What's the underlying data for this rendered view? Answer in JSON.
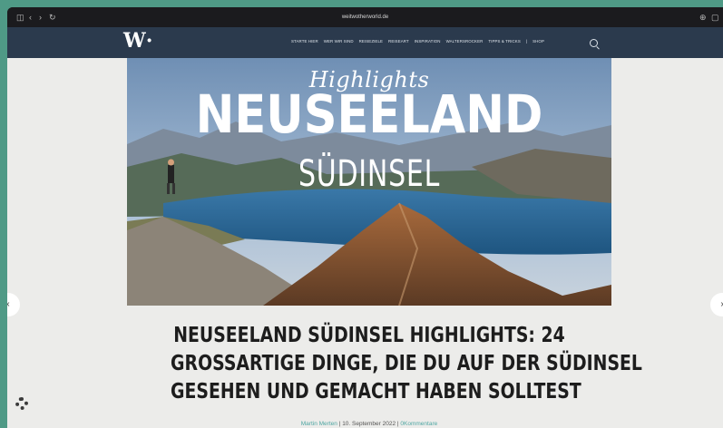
{
  "browser": {
    "url": "weitwotherworld.de",
    "sidebar_glyph": "◫",
    "back_glyph": "‹",
    "forward_glyph": "›",
    "reload_glyph": "↻",
    "share_glyph": "⊕",
    "tabs_glyph": "▢"
  },
  "site": {
    "logo": "W·",
    "menu": [
      "STARTE HIER",
      "WER WIR SIND",
      "REISEZIELE",
      "REISEART",
      "INSPIRATION",
      "WALTERSROCKER",
      "TIPPS & TRICKS",
      "|",
      "SHOP"
    ]
  },
  "hero": {
    "kicker": "Highlights",
    "title": "NEUSEELAND",
    "subtitle": "SÜDINSEL"
  },
  "article": {
    "headline_lines": [
      "NEUSEELAND SÜDINSEL HIGHLIGHTS: 24",
      "GROSSARTIGE DINGE, DIE DU AUF DER SÜDINSEL",
      "GESEHEN UND GEMACHT HABEN SOLLTEST"
    ],
    "author": "Martin Merten",
    "separator1": " | ",
    "date": "10. September 2022",
    "separator2": " | ",
    "comments": "0Kommentare"
  },
  "slider": {
    "prev_glyph": "‹",
    "next_glyph": "›"
  },
  "colors": {
    "nav_bg": "#2b3a4d",
    "accent_link": "#4fa7a3",
    "page_bg": "#ececea"
  }
}
